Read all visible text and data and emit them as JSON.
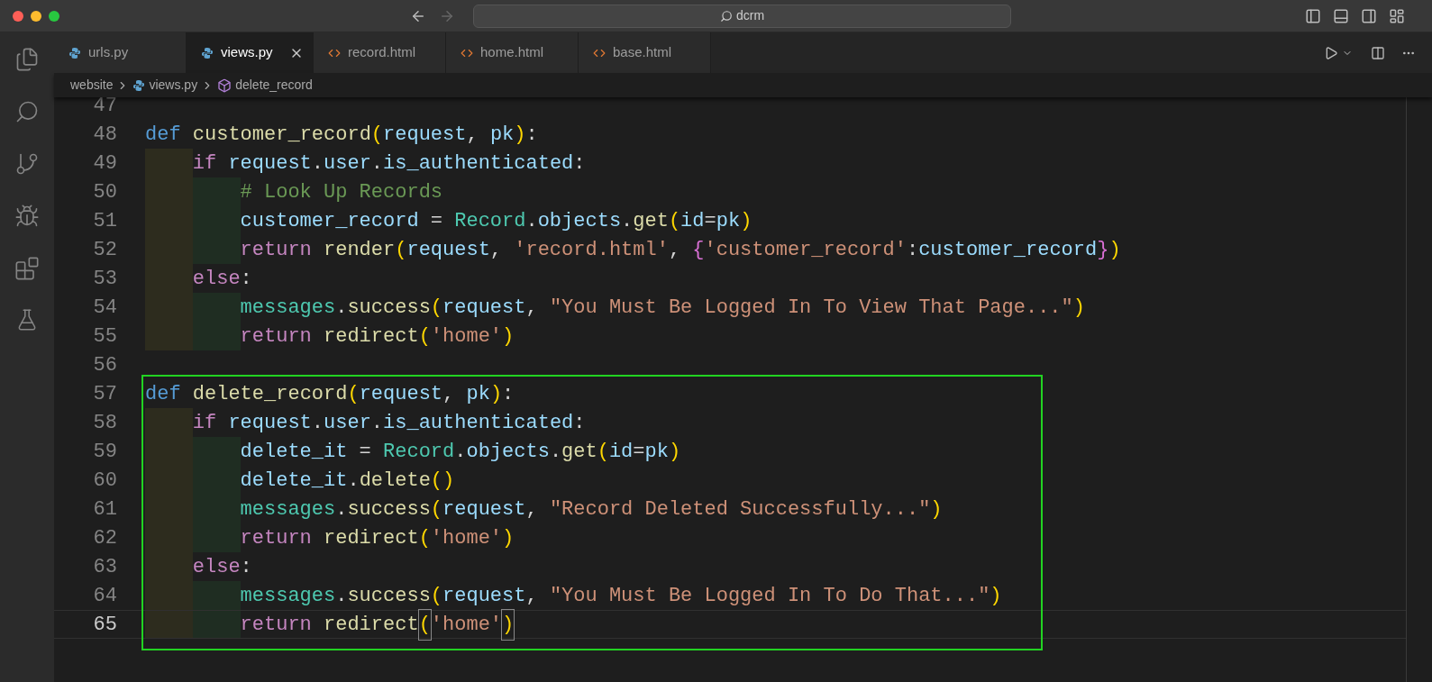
{
  "window": {
    "title": "dcrm"
  },
  "tabs": [
    {
      "label": "urls.py",
      "kind": "python",
      "selected": false
    },
    {
      "label": "views.py",
      "kind": "python",
      "selected": true
    },
    {
      "label": "record.html",
      "kind": "html",
      "selected": false
    },
    {
      "label": "home.html",
      "kind": "html",
      "selected": false
    },
    {
      "label": "base.html",
      "kind": "html",
      "selected": false
    }
  ],
  "breadcrumb": [
    {
      "label": "website",
      "kind": "folder"
    },
    {
      "label": "views.py",
      "kind": "python"
    },
    {
      "label": "delete_record",
      "kind": "symbol"
    }
  ],
  "editor": {
    "lines": [
      {
        "number": "47",
        "current": false,
        "boxed": false
      },
      {
        "number": "48",
        "current": false,
        "boxed": false,
        "tokens": [
          {
            "text": "def ",
            "kind": "kw"
          },
          {
            "text": "customer_record",
            "kind": "fn"
          },
          {
            "text": "(",
            "kind": "paren"
          },
          {
            "text": "request",
            "kind": "var"
          },
          {
            "text": ", ",
            "kind": "punc"
          },
          {
            "text": "pk",
            "kind": "var"
          },
          {
            "text": ")",
            "kind": "paren"
          },
          {
            "text": ":",
            "kind": "punc"
          }
        ],
        "children": [
          {
            "number": "49",
            "current": false,
            "tokens": [
              {
                "text": "if ",
                "kind": "ctrl"
              },
              {
                "text": "request",
                "kind": "var"
              },
              {
                "text": ".",
                "kind": "punc"
              },
              {
                "text": "user",
                "kind": "var"
              },
              {
                "text": ".",
                "kind": "punc"
              },
              {
                "text": "is_authenticated",
                "kind": "var"
              },
              {
                "text": ":",
                "kind": "punc"
              }
            ],
            "children": [
              {
                "number": "50",
                "current": false,
                "tokens": [
                  {
                    "text": "# Look Up Records",
                    "kind": "cmt"
                  }
                ]
              },
              {
                "number": "51",
                "current": false,
                "tokens": [
                  {
                    "text": "customer_record",
                    "kind": "var"
                  },
                  {
                    "text": " = ",
                    "kind": "punc"
                  },
                  {
                    "text": "Record",
                    "kind": "cls"
                  },
                  {
                    "text": ".",
                    "kind": "punc"
                  },
                  {
                    "text": "objects",
                    "kind": "var"
                  },
                  {
                    "text": ".",
                    "kind": "punc"
                  },
                  {
                    "text": "get",
                    "kind": "fn"
                  },
                  {
                    "text": "(",
                    "kind": "paren"
                  },
                  {
                    "text": "id",
                    "kind": "var"
                  },
                  {
                    "text": "=",
                    "kind": "punc"
                  },
                  {
                    "text": "pk",
                    "kind": "var"
                  },
                  {
                    "text": ")",
                    "kind": "paren"
                  }
                ]
              },
              {
                "number": "52",
                "current": false,
                "tokens": [
                  {
                    "text": "return ",
                    "kind": "ctrl"
                  },
                  {
                    "text": "render",
                    "kind": "fn"
                  },
                  {
                    "text": "(",
                    "kind": "paren"
                  },
                  {
                    "text": "request",
                    "kind": "var"
                  },
                  {
                    "text": ", ",
                    "kind": "punc"
                  },
                  {
                    "text": "'record.html'",
                    "kind": "str"
                  },
                  {
                    "text": ", ",
                    "kind": "punc"
                  },
                  {
                    "text": "{",
                    "kind": "brace"
                  },
                  {
                    "text": "'customer_record'",
                    "kind": "str"
                  },
                  {
                    "text": ":",
                    "kind": "punc"
                  },
                  {
                    "text": "customer_record",
                    "kind": "var"
                  },
                  {
                    "text": "}",
                    "kind": "brace"
                  },
                  {
                    "text": ")",
                    "kind": "paren"
                  }
                ]
              }
            ]
          },
          {
            "number": "53",
            "current": false,
            "tokens": [
              {
                "text": "else",
                "kind": "ctrl"
              },
              {
                "text": ":",
                "kind": "punc"
              }
            ],
            "children": [
              {
                "number": "54",
                "current": false,
                "tokens": [
                  {
                    "text": "messages",
                    "kind": "cls"
                  },
                  {
                    "text": ".",
                    "kind": "punc"
                  },
                  {
                    "text": "success",
                    "kind": "fn"
                  },
                  {
                    "text": "(",
                    "kind": "paren"
                  },
                  {
                    "text": "request",
                    "kind": "var"
                  },
                  {
                    "text": ", ",
                    "kind": "punc"
                  },
                  {
                    "text": "\"You Must Be Logged In To View That Page...\"",
                    "kind": "str"
                  },
                  {
                    "text": ")",
                    "kind": "paren"
                  }
                ]
              },
              {
                "number": "55",
                "current": false,
                "tokens": [
                  {
                    "text": "return ",
                    "kind": "ctrl"
                  },
                  {
                    "text": "redirect",
                    "kind": "fn"
                  },
                  {
                    "text": "(",
                    "kind": "paren"
                  },
                  {
                    "text": "'home'",
                    "kind": "str"
                  },
                  {
                    "text": ")",
                    "kind": "paren"
                  }
                ]
              }
            ]
          }
        ]
      },
      {
        "number": "56",
        "current": false,
        "boxed": false
      },
      {
        "number": "57",
        "current": false,
        "boxed": true,
        "tokens": [
          {
            "text": "def ",
            "kind": "kw"
          },
          {
            "text": "delete_record",
            "kind": "fn"
          },
          {
            "text": "(",
            "kind": "paren"
          },
          {
            "text": "request",
            "kind": "var"
          },
          {
            "text": ", ",
            "kind": "punc"
          },
          {
            "text": "pk",
            "kind": "var"
          },
          {
            "text": ")",
            "kind": "paren"
          },
          {
            "text": ":",
            "kind": "punc"
          }
        ],
        "children": [
          {
            "number": "58",
            "current": false,
            "tokens": [
              {
                "text": "if ",
                "kind": "ctrl"
              },
              {
                "text": "request",
                "kind": "var"
              },
              {
                "text": ".",
                "kind": "punc"
              },
              {
                "text": "user",
                "kind": "var"
              },
              {
                "text": ".",
                "kind": "punc"
              },
              {
                "text": "is_authenticated",
                "kind": "var"
              },
              {
                "text": ":",
                "kind": "punc"
              }
            ],
            "children": [
              {
                "number": "59",
                "current": false,
                "tokens": [
                  {
                    "text": "delete_it",
                    "kind": "var"
                  },
                  {
                    "text": " = ",
                    "kind": "punc"
                  },
                  {
                    "text": "Record",
                    "kind": "cls"
                  },
                  {
                    "text": ".",
                    "kind": "punc"
                  },
                  {
                    "text": "objects",
                    "kind": "var"
                  },
                  {
                    "text": ".",
                    "kind": "punc"
                  },
                  {
                    "text": "get",
                    "kind": "fn"
                  },
                  {
                    "text": "(",
                    "kind": "paren"
                  },
                  {
                    "text": "id",
                    "kind": "var"
                  },
                  {
                    "text": "=",
                    "kind": "punc"
                  },
                  {
                    "text": "pk",
                    "kind": "var"
                  },
                  {
                    "text": ")",
                    "kind": "paren"
                  }
                ]
              },
              {
                "number": "60",
                "current": false,
                "tokens": [
                  {
                    "text": "delete_it",
                    "kind": "var"
                  },
                  {
                    "text": ".",
                    "kind": "punc"
                  },
                  {
                    "text": "delete",
                    "kind": "fn"
                  },
                  {
                    "text": "()",
                    "kind": "paren"
                  }
                ]
              },
              {
                "number": "61",
                "current": false,
                "tokens": [
                  {
                    "text": "messages",
                    "kind": "cls"
                  },
                  {
                    "text": ".",
                    "kind": "punc"
                  },
                  {
                    "text": "success",
                    "kind": "fn"
                  },
                  {
                    "text": "(",
                    "kind": "paren"
                  },
                  {
                    "text": "request",
                    "kind": "var"
                  },
                  {
                    "text": ", ",
                    "kind": "punc"
                  },
                  {
                    "text": "\"Record Deleted Successfully...\"",
                    "kind": "str"
                  },
                  {
                    "text": ")",
                    "kind": "paren"
                  }
                ]
              },
              {
                "number": "62",
                "current": false,
                "tokens": [
                  {
                    "text": "return ",
                    "kind": "ctrl"
                  },
                  {
                    "text": "redirect",
                    "kind": "fn"
                  },
                  {
                    "text": "(",
                    "kind": "paren"
                  },
                  {
                    "text": "'home'",
                    "kind": "str"
                  },
                  {
                    "text": ")",
                    "kind": "paren"
                  }
                ]
              }
            ]
          },
          {
            "number": "63",
            "current": false,
            "tokens": [
              {
                "text": "else",
                "kind": "ctrl"
              },
              {
                "text": ":",
                "kind": "punc"
              }
            ],
            "children": [
              {
                "number": "64",
                "current": false,
                "tokens": [
                  {
                    "text": "messages",
                    "kind": "cls"
                  },
                  {
                    "text": ".",
                    "kind": "punc"
                  },
                  {
                    "text": "success",
                    "kind": "fn"
                  },
                  {
                    "text": "(",
                    "kind": "paren"
                  },
                  {
                    "text": "request",
                    "kind": "var"
                  },
                  {
                    "text": ", ",
                    "kind": "punc"
                  },
                  {
                    "text": "\"You Must Be Logged In To Do That...\"",
                    "kind": "str"
                  },
                  {
                    "text": ")",
                    "kind": "paren"
                  }
                ]
              },
              {
                "number": "65",
                "current": true,
                "tokens": [
                  {
                    "text": "return ",
                    "kind": "ctrl"
                  },
                  {
                    "text": "redirect",
                    "kind": "fn"
                  },
                  {
                    "text": "(",
                    "kind": "matched"
                  },
                  {
                    "text": "'home'",
                    "kind": "str"
                  },
                  {
                    "text": ")",
                    "kind": "matched"
                  }
                ]
              }
            ]
          }
        ]
      }
    ]
  }
}
